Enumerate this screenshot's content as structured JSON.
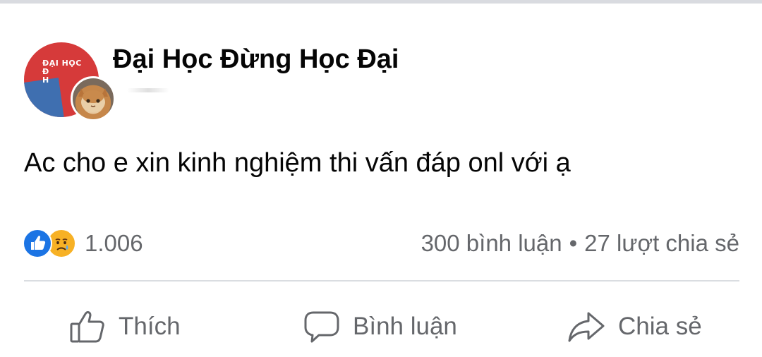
{
  "post": {
    "page_name": "Đại Học Đừng Học Đại",
    "avatar": {
      "logo_text_line1": "ĐẠI HỌC",
      "logo_text_line2": "Đ",
      "logo_text_line3": "H",
      "icon": "page-logo-icon",
      "overlay_icon": "cat-avatar-icon"
    },
    "text": "Ac cho e xin kinh nghiệm thi vấn đáp onl với ạ",
    "reactions": {
      "icons": [
        "like-reaction-icon",
        "sad-reaction-icon"
      ],
      "count": "1.006"
    },
    "stats": {
      "comments": "300 bình luận",
      "separator": "•",
      "shares": "27 lượt chia sẻ"
    },
    "actions": {
      "like_label": "Thích",
      "comment_label": "Bình luận",
      "share_label": "Chia sẻ"
    }
  },
  "colors": {
    "like_blue": "#1b74e4",
    "sad_yellow": "#f7b125",
    "secondary_text": "#65676b",
    "divider": "#dadde1"
  }
}
